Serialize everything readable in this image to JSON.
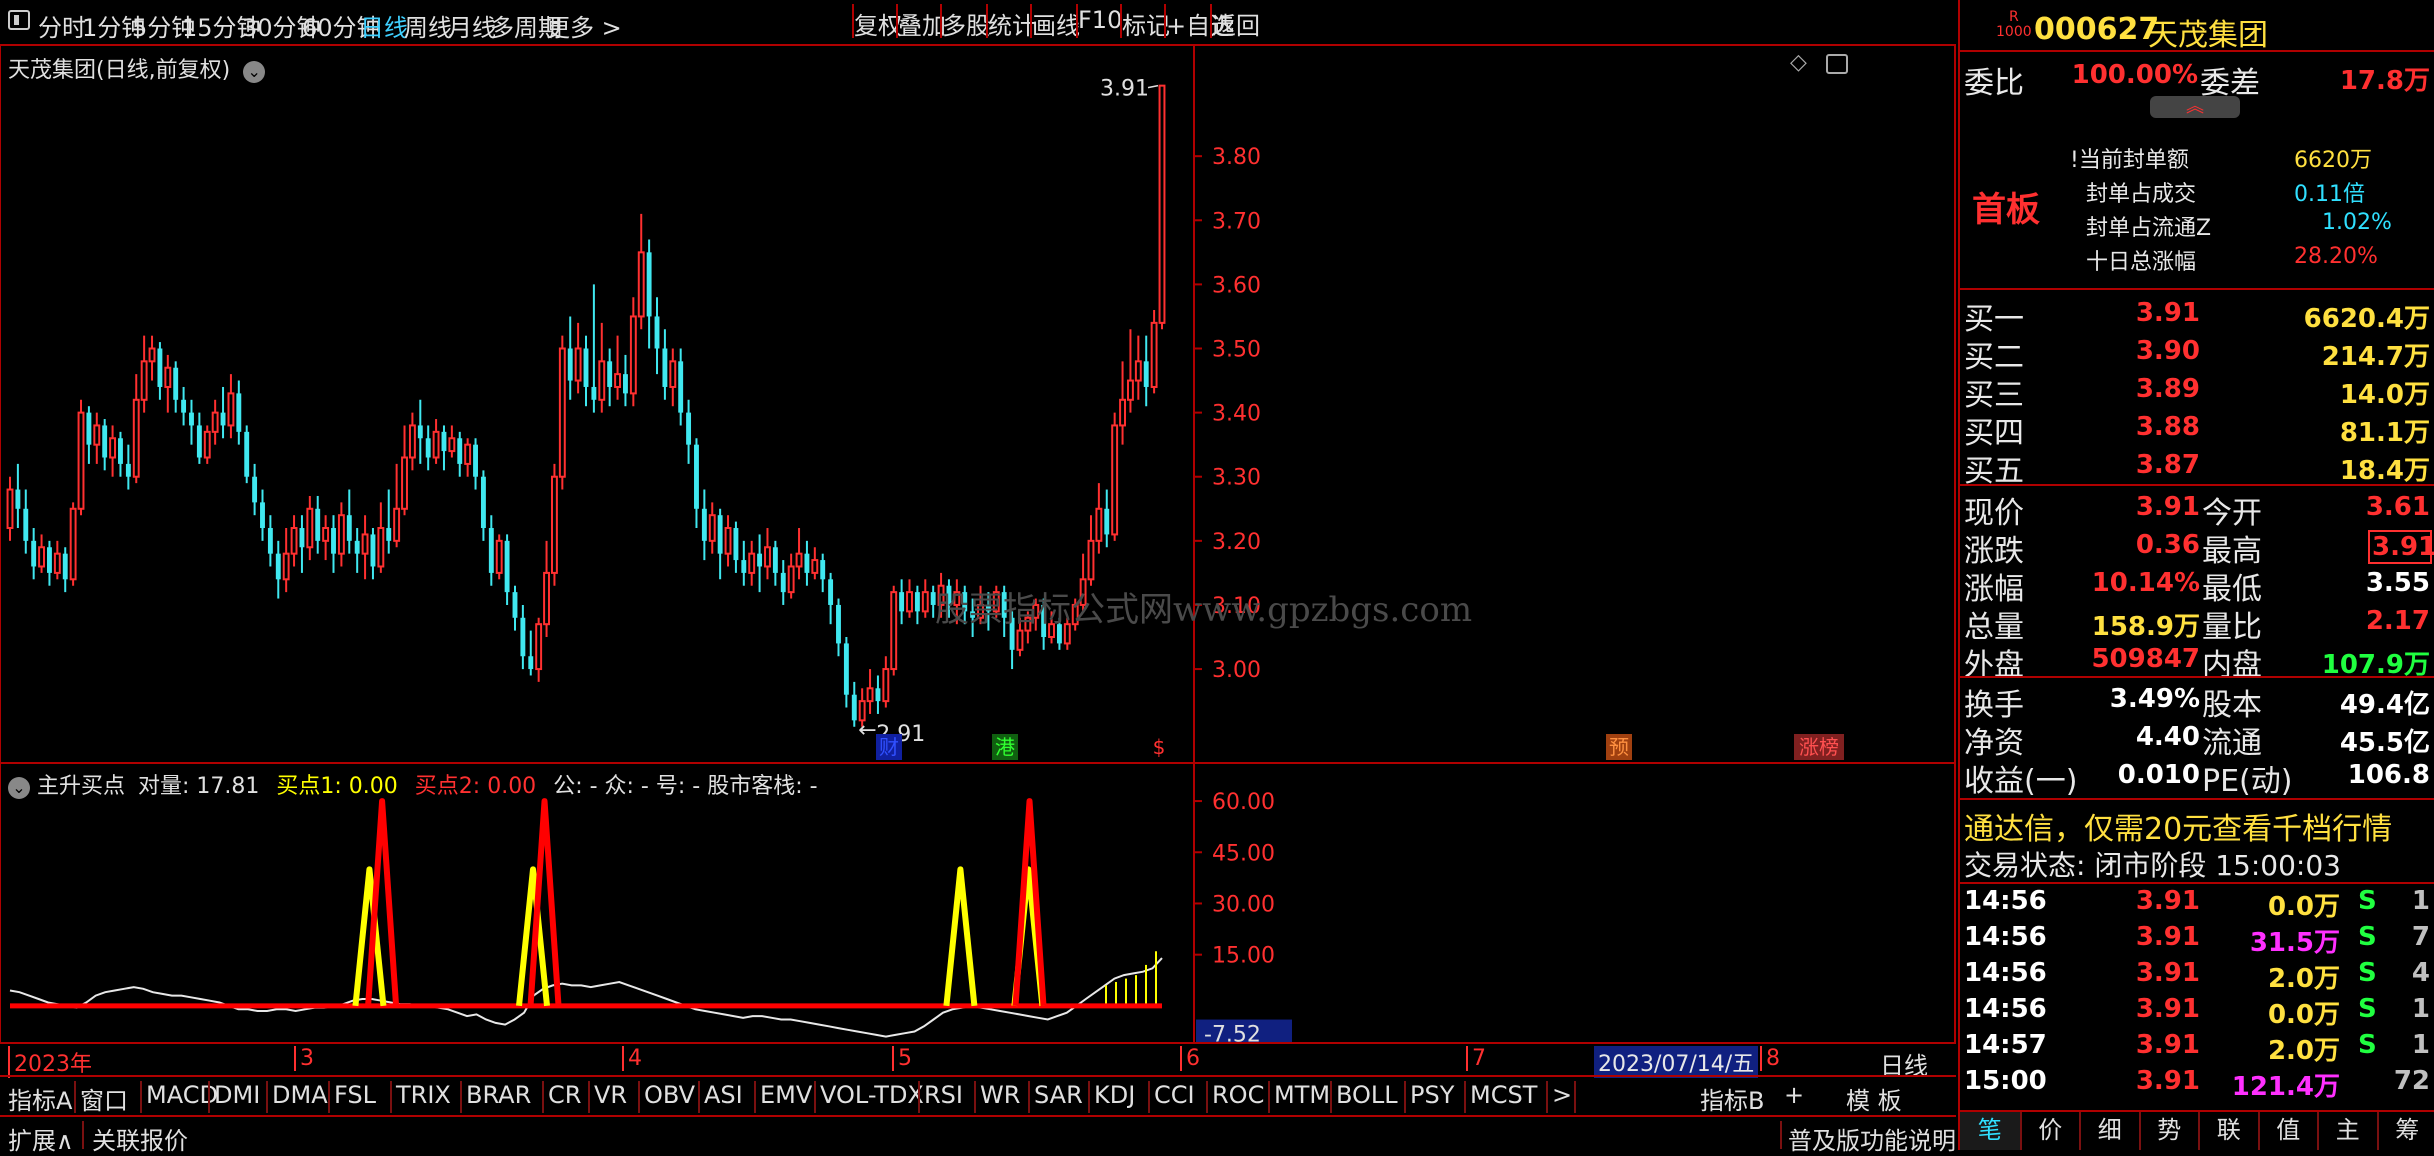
{
  "toolbar": {
    "periods": [
      "分时",
      "1分钟",
      "5分钟",
      "15分钟",
      "30分钟",
      "60分钟",
      "日线",
      "周线",
      "月线",
      "多周期",
      "更多 >"
    ],
    "active_period": "日线",
    "buttons": [
      "复权",
      "叠加",
      "多股",
      "统计",
      "画线",
      "F10",
      "标记",
      "+自选",
      "返回"
    ]
  },
  "kline": {
    "title": "天茂集团(日线,前复权)",
    "y_ticks": [
      "3.80",
      "3.70",
      "3.60",
      "3.50",
      "3.40",
      "3.30",
      "3.20",
      "3.10",
      "3.00"
    ],
    "high_label": "3.91",
    "low_label": "2.91",
    "watermark": "股票指标公式网www.gpzbgs.com",
    "events": [
      {
        "text": "财",
        "color": "#3050ff",
        "bg": "#1020a0"
      },
      {
        "text": "港",
        "color": "#30ff30",
        "bg": "#106010"
      },
      {
        "text": "$",
        "color": "#ff3030",
        "bg": "#000000"
      },
      {
        "text": "预",
        "color": "#ff9040",
        "bg": "#a04010"
      },
      {
        "text": "涨榜",
        "color": "#ff5050",
        "bg": "#802020"
      }
    ]
  },
  "indicator": {
    "name": "主升买点",
    "param": "对量: 17.81",
    "buy1": "买点1: 0.00",
    "buy2": "买点2: 0.00",
    "extra": "公: -  众: -  号: -  股市客栈: -",
    "y_ticks": [
      "60.00",
      "45.00",
      "30.00",
      "15.00"
    ],
    "current": "-7.52",
    "line_color": "#ff0000",
    "buy1_color": "#ffff00"
  },
  "date_axis": {
    "labels": [
      "2023年",
      "3",
      "4",
      "5",
      "6",
      "7",
      "8"
    ],
    "cursor_date": "2023/07/14/五",
    "period": "日线"
  },
  "ind_tabs": [
    "指标A",
    "窗口",
    "MACD",
    "DMI",
    "DMA",
    "FSL",
    "TRIX",
    "BRAR",
    "CR",
    "VR",
    "OBV",
    "ASI",
    "EMV",
    "VOL-TDX",
    "RSI",
    "WR",
    "SAR",
    "KDJ",
    "CCI",
    "ROC",
    "MTM",
    "BOLL",
    "PSY",
    "MCST",
    ">"
  ],
  "ind_tabs_right": [
    "指标B",
    "+",
    "模 板"
  ],
  "bottom": {
    "left": [
      "扩展∧",
      "关联报价"
    ],
    "right": "普及版功能说明",
    "tabs": [
      "笔",
      "价",
      "细",
      "势",
      "联",
      "值",
      "主",
      "筹"
    ]
  },
  "quote": {
    "badge_top": "R",
    "badge_bottom": "1000",
    "code": "000627",
    "name": "天茂集团",
    "weibi_label": "委比",
    "weibi": "100.00%",
    "weicha_label": "委差",
    "weicha": "17.8万",
    "board_tag": "首板",
    "seal": [
      {
        "label": "当前封单额",
        "value": "6620万",
        "color": "#ffe040"
      },
      {
        "label": "封单占成交",
        "value": "0.11倍",
        "color": "#30e0ff"
      },
      {
        "label": "封单占流通Z",
        "value": "1.02%",
        "color": "#30e0ff"
      },
      {
        "label": "十日总涨幅",
        "value": "28.20%",
        "color": "#ff3030"
      }
    ],
    "bids": [
      {
        "label": "买一",
        "price": "3.91",
        "vol": "6620.4万"
      },
      {
        "label": "买二",
        "price": "3.90",
        "vol": "214.7万"
      },
      {
        "label": "买三",
        "price": "3.89",
        "vol": "14.0万"
      },
      {
        "label": "买四",
        "price": "3.88",
        "vol": "81.1万"
      },
      {
        "label": "买五",
        "price": "3.87",
        "vol": "18.4万"
      }
    ],
    "stats": [
      {
        "l1": "现价",
        "v1": "3.91",
        "c1": "#ff3030",
        "l2": "今开",
        "v2": "3.61",
        "c2": "#ff3030"
      },
      {
        "l1": "涨跌",
        "v1": "0.36",
        "c1": "#ff3030",
        "l2": "最高",
        "v2": "3.91",
        "c2": "#ff3030"
      },
      {
        "l1": "涨幅",
        "v1": "10.14%",
        "c1": "#ff3030",
        "l2": "最低",
        "v2": "3.55",
        "c2": "#ffffff"
      },
      {
        "l1": "总量",
        "v1": "158.9万",
        "c1": "#ffe040",
        "l2": "量比",
        "v2": "2.17",
        "c2": "#ff3030"
      },
      {
        "l1": "外盘",
        "v1": "509847",
        "c1": "#ff3030",
        "l2": "内盘",
        "v2": "107.9万",
        "c2": "#20ff40"
      }
    ],
    "fund": [
      {
        "l1": "换手",
        "v1": "3.49%",
        "l2": "股本",
        "v2": "49.4亿"
      },
      {
        "l1": "净资",
        "v1": "4.40",
        "l2": "流通",
        "v2": "45.5亿"
      },
      {
        "l1": "收益(一)",
        "v1": "0.010",
        "l2": "PE(动)",
        "v2": "106.8"
      }
    ],
    "promo": "通达信，仅需20元查看千档行情",
    "trade_status": "交易状态: 闭市阶段 15:00:03",
    "ticks": [
      {
        "time": "14:56",
        "price": "3.91",
        "vol": "0.0万",
        "volColor": "#ffe040",
        "side": "S",
        "n": "1"
      },
      {
        "time": "14:56",
        "price": "3.91",
        "vol": "31.5万",
        "volColor": "#ff30ff",
        "side": "S",
        "n": "7"
      },
      {
        "time": "14:56",
        "price": "3.91",
        "vol": "2.0万",
        "volColor": "#ffe040",
        "side": "S",
        "n": "4"
      },
      {
        "time": "14:56",
        "price": "3.91",
        "vol": "0.0万",
        "volColor": "#ffe040",
        "side": "S",
        "n": "1"
      },
      {
        "time": "14:57",
        "price": "3.91",
        "vol": "2.0万",
        "volColor": "#ffe040",
        "side": "S",
        "n": "1"
      },
      {
        "time": "15:00",
        "price": "3.91",
        "vol": "121.4万",
        "volColor": "#ff30ff",
        "side": "",
        "n": "72"
      }
    ]
  },
  "chart_data": {
    "type": "candlestick",
    "y_range": [
      2.88,
      3.95
    ],
    "candles": [
      [
        3.22,
        3.28,
        3.2,
        3.3
      ],
      [
        3.28,
        3.25,
        3.22,
        3.32
      ],
      [
        3.25,
        3.2,
        3.18,
        3.28
      ],
      [
        3.2,
        3.16,
        3.14,
        3.22
      ],
      [
        3.16,
        3.19,
        3.15,
        3.21
      ],
      [
        3.19,
        3.15,
        3.13,
        3.2
      ],
      [
        3.15,
        3.18,
        3.14,
        3.2
      ],
      [
        3.18,
        3.14,
        3.12,
        3.19
      ],
      [
        3.14,
        3.25,
        3.13,
        3.26
      ],
      [
        3.25,
        3.4,
        3.24,
        3.42
      ],
      [
        3.4,
        3.35,
        3.32,
        3.41
      ],
      [
        3.35,
        3.38,
        3.32,
        3.4
      ],
      [
        3.38,
        3.33,
        3.31,
        3.39
      ],
      [
        3.33,
        3.36,
        3.3,
        3.38
      ],
      [
        3.36,
        3.32,
        3.3,
        3.37
      ],
      [
        3.32,
        3.3,
        3.28,
        3.35
      ],
      [
        3.3,
        3.42,
        3.29,
        3.46
      ],
      [
        3.42,
        3.48,
        3.4,
        3.52
      ],
      [
        3.48,
        3.5,
        3.45,
        3.52
      ],
      [
        3.5,
        3.44,
        3.42,
        3.51
      ],
      [
        3.44,
        3.47,
        3.4,
        3.49
      ],
      [
        3.47,
        3.42,
        3.4,
        3.48
      ],
      [
        3.42,
        3.4,
        3.38,
        3.44
      ],
      [
        3.4,
        3.38,
        3.35,
        3.42
      ],
      [
        3.38,
        3.33,
        3.32,
        3.4
      ],
      [
        3.33,
        3.37,
        3.32,
        3.38
      ],
      [
        3.37,
        3.4,
        3.35,
        3.42
      ],
      [
        3.4,
        3.38,
        3.36,
        3.44
      ],
      [
        3.38,
        3.43,
        3.36,
        3.46
      ],
      [
        3.43,
        3.37,
        3.35,
        3.45
      ],
      [
        3.37,
        3.3,
        3.29,
        3.38
      ],
      [
        3.3,
        3.26,
        3.24,
        3.32
      ],
      [
        3.26,
        3.22,
        3.2,
        3.28
      ],
      [
        3.22,
        3.18,
        3.16,
        3.24
      ],
      [
        3.18,
        3.14,
        3.11,
        3.2
      ],
      [
        3.14,
        3.18,
        3.12,
        3.22
      ],
      [
        3.18,
        3.22,
        3.16,
        3.24
      ],
      [
        3.22,
        3.19,
        3.15,
        3.24
      ],
      [
        3.19,
        3.25,
        3.17,
        3.27
      ],
      [
        3.25,
        3.2,
        3.18,
        3.27
      ],
      [
        3.2,
        3.22,
        3.17,
        3.24
      ],
      [
        3.22,
        3.18,
        3.15,
        3.24
      ],
      [
        3.18,
        3.24,
        3.16,
        3.26
      ],
      [
        3.24,
        3.2,
        3.18,
        3.28
      ],
      [
        3.2,
        3.18,
        3.15,
        3.22
      ],
      [
        3.18,
        3.21,
        3.14,
        3.24
      ],
      [
        3.21,
        3.16,
        3.14,
        3.22
      ],
      [
        3.16,
        3.22,
        3.15,
        3.26
      ],
      [
        3.22,
        3.2,
        3.18,
        3.28
      ],
      [
        3.2,
        3.25,
        3.19,
        3.32
      ],
      [
        3.25,
        3.33,
        3.24,
        3.38
      ],
      [
        3.33,
        3.38,
        3.31,
        3.4
      ],
      [
        3.38,
        3.36,
        3.32,
        3.42
      ],
      [
        3.36,
        3.33,
        3.31,
        3.38
      ],
      [
        3.33,
        3.37,
        3.32,
        3.39
      ],
      [
        3.37,
        3.34,
        3.31,
        3.38
      ],
      [
        3.34,
        3.36,
        3.33,
        3.38
      ],
      [
        3.36,
        3.32,
        3.3,
        3.37
      ],
      [
        3.32,
        3.35,
        3.3,
        3.36
      ],
      [
        3.35,
        3.3,
        3.28,
        3.36
      ],
      [
        3.3,
        3.22,
        3.2,
        3.31
      ],
      [
        3.22,
        3.15,
        3.13,
        3.24
      ],
      [
        3.15,
        3.2,
        3.14,
        3.21
      ],
      [
        3.2,
        3.12,
        3.1,
        3.21
      ],
      [
        3.12,
        3.08,
        3.06,
        3.13
      ],
      [
        3.08,
        3.02,
        3.0,
        3.1
      ],
      [
        3.02,
        3.0,
        2.99,
        3.06
      ],
      [
        3.0,
        3.07,
        2.98,
        3.08
      ],
      [
        3.07,
        3.15,
        3.05,
        3.2
      ],
      [
        3.15,
        3.3,
        3.13,
        3.32
      ],
      [
        3.3,
        3.5,
        3.28,
        3.52
      ],
      [
        3.5,
        3.45,
        3.42,
        3.55
      ],
      [
        3.45,
        3.5,
        3.43,
        3.54
      ],
      [
        3.5,
        3.44,
        3.41,
        3.52
      ],
      [
        3.44,
        3.42,
        3.4,
        3.6
      ],
      [
        3.42,
        3.48,
        3.4,
        3.54
      ],
      [
        3.48,
        3.44,
        3.41,
        3.5
      ],
      [
        3.44,
        3.46,
        3.42,
        3.52
      ],
      [
        3.46,
        3.43,
        3.41,
        3.49
      ],
      [
        3.43,
        3.55,
        3.41,
        3.58
      ],
      [
        3.55,
        3.65,
        3.53,
        3.71
      ],
      [
        3.65,
        3.55,
        3.5,
        3.67
      ],
      [
        3.55,
        3.5,
        3.46,
        3.58
      ],
      [
        3.5,
        3.44,
        3.42,
        3.53
      ],
      [
        3.44,
        3.48,
        3.41,
        3.5
      ],
      [
        3.48,
        3.4,
        3.38,
        3.5
      ],
      [
        3.4,
        3.35,
        3.32,
        3.42
      ],
      [
        3.35,
        3.25,
        3.22,
        3.36
      ],
      [
        3.25,
        3.2,
        3.17,
        3.28
      ],
      [
        3.2,
        3.24,
        3.18,
        3.26
      ],
      [
        3.24,
        3.18,
        3.14,
        3.25
      ],
      [
        3.18,
        3.22,
        3.16,
        3.24
      ],
      [
        3.22,
        3.17,
        3.15,
        3.23
      ],
      [
        3.17,
        3.15,
        3.13,
        3.2
      ],
      [
        3.15,
        3.18,
        3.13,
        3.2
      ],
      [
        3.18,
        3.16,
        3.12,
        3.21
      ],
      [
        3.16,
        3.19,
        3.14,
        3.22
      ],
      [
        3.19,
        3.15,
        3.13,
        3.2
      ],
      [
        3.15,
        3.12,
        3.1,
        3.17
      ],
      [
        3.12,
        3.16,
        3.11,
        3.18
      ],
      [
        3.16,
        3.18,
        3.14,
        3.22
      ],
      [
        3.18,
        3.15,
        3.13,
        3.2
      ],
      [
        3.15,
        3.17,
        3.14,
        3.19
      ],
      [
        3.17,
        3.14,
        3.12,
        3.18
      ],
      [
        3.14,
        3.1,
        3.07,
        3.15
      ],
      [
        3.1,
        3.04,
        3.02,
        3.11
      ],
      [
        3.04,
        2.96,
        2.94,
        3.05
      ],
      [
        2.96,
        2.92,
        2.91,
        2.98
      ],
      [
        2.92,
        2.95,
        2.91,
        2.97
      ],
      [
        2.95,
        2.97,
        2.93,
        3.0
      ],
      [
        2.97,
        2.95,
        2.93,
        2.99
      ],
      [
        2.95,
        3.0,
        2.94,
        3.02
      ],
      [
        3.0,
        3.12,
        2.99,
        3.13
      ],
      [
        3.12,
        3.09,
        3.07,
        3.14
      ],
      [
        3.09,
        3.12,
        3.08,
        3.14
      ],
      [
        3.12,
        3.09,
        3.07,
        3.13
      ],
      [
        3.09,
        3.12,
        3.08,
        3.14
      ],
      [
        3.12,
        3.1,
        3.08,
        3.13
      ],
      [
        3.1,
        3.13,
        3.08,
        3.15
      ],
      [
        3.13,
        3.1,
        3.08,
        3.14
      ],
      [
        3.1,
        3.12,
        3.07,
        3.14
      ],
      [
        3.12,
        3.09,
        3.07,
        3.13
      ],
      [
        3.09,
        3.08,
        3.05,
        3.11
      ],
      [
        3.08,
        3.1,
        3.07,
        3.13
      ],
      [
        3.1,
        3.09,
        3.06,
        3.12
      ],
      [
        3.09,
        3.12,
        3.08,
        3.13
      ],
      [
        3.12,
        3.08,
        3.05,
        3.13
      ],
      [
        3.08,
        3.03,
        3.0,
        3.09
      ],
      [
        3.03,
        3.06,
        3.02,
        3.08
      ],
      [
        3.06,
        3.08,
        3.04,
        3.09
      ],
      [
        3.08,
        3.1,
        3.06,
        3.11
      ],
      [
        3.1,
        3.05,
        3.03,
        3.11
      ],
      [
        3.05,
        3.07,
        3.04,
        3.09
      ],
      [
        3.07,
        3.04,
        3.03,
        3.08
      ],
      [
        3.04,
        3.07,
        3.03,
        3.08
      ],
      [
        3.07,
        3.1,
        3.06,
        3.11
      ],
      [
        3.1,
        3.14,
        3.09,
        3.18
      ],
      [
        3.14,
        3.2,
        3.13,
        3.24
      ],
      [
        3.2,
        3.25,
        3.18,
        3.29
      ],
      [
        3.25,
        3.21,
        3.19,
        3.28
      ],
      [
        3.21,
        3.38,
        3.2,
        3.4
      ],
      [
        3.38,
        3.42,
        3.35,
        3.48
      ],
      [
        3.42,
        3.45,
        3.4,
        3.53
      ],
      [
        3.45,
        3.48,
        3.42,
        3.52
      ],
      [
        3.48,
        3.44,
        3.41,
        3.52
      ],
      [
        3.44,
        3.54,
        3.43,
        3.56
      ],
      [
        3.54,
        3.91,
        3.53,
        3.91
      ]
    ],
    "indicator": {
      "y_range": [
        -10,
        65
      ],
      "line": [
        4.5,
        4.0,
        3.0,
        2.0,
        1.0,
        0.5,
        0.0,
        -0.5,
        1.0,
        3.0,
        4.0,
        4.5,
        5.0,
        5.5,
        5.0,
        4.0,
        3.5,
        3.0,
        3.0,
        2.5,
        2.0,
        1.5,
        1.0,
        0.0,
        -1.0,
        -1.0,
        -1.5,
        -1.5,
        -1.0,
        -1.0,
        -1.5,
        -1.0,
        -0.5,
        -0.5,
        0.0,
        0.5,
        1.5,
        2.0,
        2.0,
        1.5,
        1.0,
        0.5,
        0.5,
        0.0,
        0.0,
        -0.5,
        -1.0,
        -2.0,
        -3.0,
        -2.5,
        -4.0,
        -5.0,
        -5.5,
        -4.0,
        -2.0,
        3.0,
        5.0,
        6.0,
        6.5,
        6.0,
        6.0,
        5.5,
        6.0,
        6.5,
        7.0,
        6.0,
        5.0,
        4.0,
        3.0,
        2.0,
        1.0,
        0.0,
        -1.0,
        -1.5,
        -2.0,
        -2.5,
        -3.0,
        -3.5,
        -3.0,
        -3.0,
        -3.5,
        -4.0,
        -4.0,
        -4.5,
        -5.0,
        -5.5,
        -6.0,
        -6.5,
        -7.0,
        -7.5,
        -8.0,
        -8.5,
        -9.0,
        -8.5,
        -8.0,
        -7.5,
        -6.0,
        -4.0,
        -2.0,
        -1.0,
        -0.5,
        0.0,
        -0.5,
        -1.0,
        -1.5,
        -2.0,
        -2.5,
        -3.0,
        -3.5,
        -4.0,
        -3.0,
        -2.0,
        0.0,
        2.0,
        4.0,
        6.0,
        8.0,
        9.0,
        9.5,
        10.0,
        11.0,
        14.0
      ],
      "buy2_peaks": [
        {
          "x": 0.323,
          "v": 60
        },
        {
          "x": 0.464,
          "v": 60
        },
        {
          "x": 0.885,
          "v": 60
        }
      ],
      "buy1_peaks": [
        {
          "x": 0.312,
          "v": 40
        },
        {
          "x": 0.454,
          "v": 40
        },
        {
          "x": 0.825,
          "v": 40
        },
        {
          "x": 0.884,
          "v": 40
        }
      ]
    }
  }
}
